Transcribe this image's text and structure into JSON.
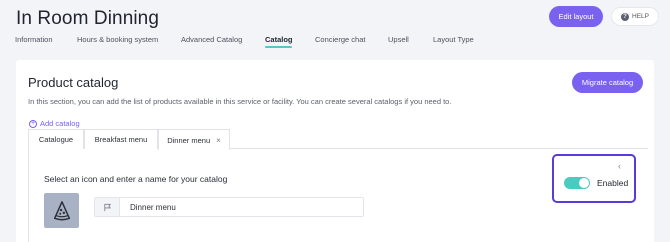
{
  "header": {
    "title": "In Room Dinning",
    "edit_layout_label": "Edit layout",
    "help_label": "HELP",
    "help_icon": "question-circle-icon"
  },
  "nav": {
    "tabs": [
      {
        "label": "Information"
      },
      {
        "label": "Hours & booking system"
      },
      {
        "label": "Advanced Catalog"
      },
      {
        "label": "Catalog",
        "active": true
      },
      {
        "label": "Concierge chat"
      },
      {
        "label": "Upsell"
      },
      {
        "label": "Layout Type"
      }
    ]
  },
  "product_catalog": {
    "title": "Product catalog",
    "migrate_label": "Migrate catalog",
    "description": "In this section, you can add the list of products available in this service or facility. You can create several catalogs if you need to.",
    "add_catalog_label": "Add catalog",
    "tabs": [
      {
        "label": "Catalogue"
      },
      {
        "label": "Breakfast menu"
      },
      {
        "label": "Dinner menu",
        "active": true,
        "closable": true
      }
    ],
    "close_glyph": "×",
    "select_label": "Select an icon and enter a name for your catalog",
    "selected_icon": "pizza-slice-icon",
    "name_value": "Dinner menu",
    "status": {
      "label": "Enabled",
      "enabled": true,
      "collapse_glyph": "‹"
    }
  },
  "colors": {
    "accent": "#7b61f0",
    "toggle_on": "#4ccac1",
    "active_tab_underline": "#55c7c4",
    "highlight_border": "#5b3bd6"
  }
}
